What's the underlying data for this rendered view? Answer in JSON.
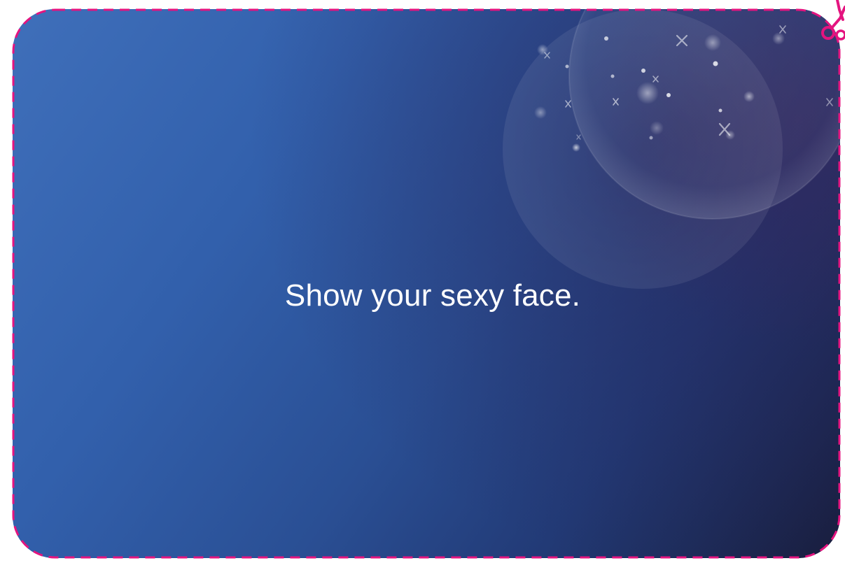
{
  "card": {
    "text": "Show your sexy face."
  },
  "colors": {
    "cut_line": "#e4147f",
    "card_top_left": "#3f6fba",
    "card_bottom_right": "#191d3d",
    "text": "#ffffff"
  },
  "icons": {
    "cut_marker": "scissors-icon"
  }
}
